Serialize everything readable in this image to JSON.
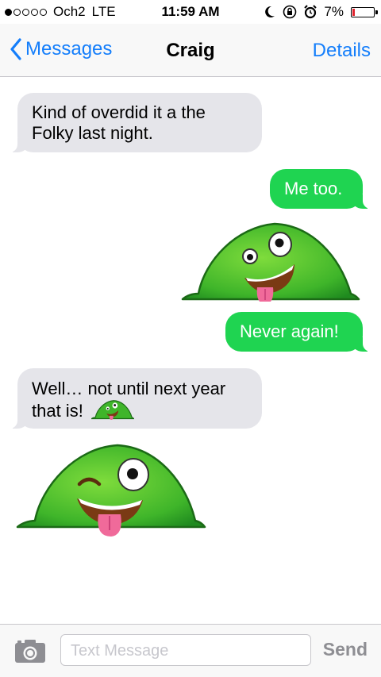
{
  "status_bar": {
    "signal_bars_filled": 1,
    "signal_bars_total": 5,
    "carrier": "Och2",
    "network": "LTE",
    "time": "11:59 AM",
    "battery": "7%",
    "icons": [
      "moon-icon",
      "rotation-lock-icon",
      "alarm-icon",
      "battery-icon"
    ]
  },
  "nav": {
    "back_label": "Messages",
    "title": "Craig",
    "details_label": "Details"
  },
  "messages": [
    {
      "direction": "incoming",
      "type": "text",
      "text_line1": "Kind of overdid it a the",
      "text_line2": "Folky last night."
    },
    {
      "direction": "outgoing",
      "type": "text",
      "text": "Me too."
    },
    {
      "direction": "outgoing",
      "type": "sticker",
      "sticker": "green-blob-tongue-sticker"
    },
    {
      "direction": "outgoing",
      "type": "text",
      "text": "Never again!"
    },
    {
      "direction": "incoming",
      "type": "text",
      "text_line1": "Well… not until next year",
      "text_line2": "that is!",
      "inline_sticker": "green-blob-tongue-sticker"
    },
    {
      "direction": "incoming",
      "type": "sticker",
      "sticker": "green-blob-wink-sticker"
    }
  ],
  "input": {
    "placeholder": "Text Message",
    "send_label": "Send"
  },
  "colors": {
    "ios_blue": "#147efb",
    "outgoing_green": "#1fd451",
    "incoming_gray": "#e5e5ea",
    "battery_low_red": "#e0232e"
  }
}
